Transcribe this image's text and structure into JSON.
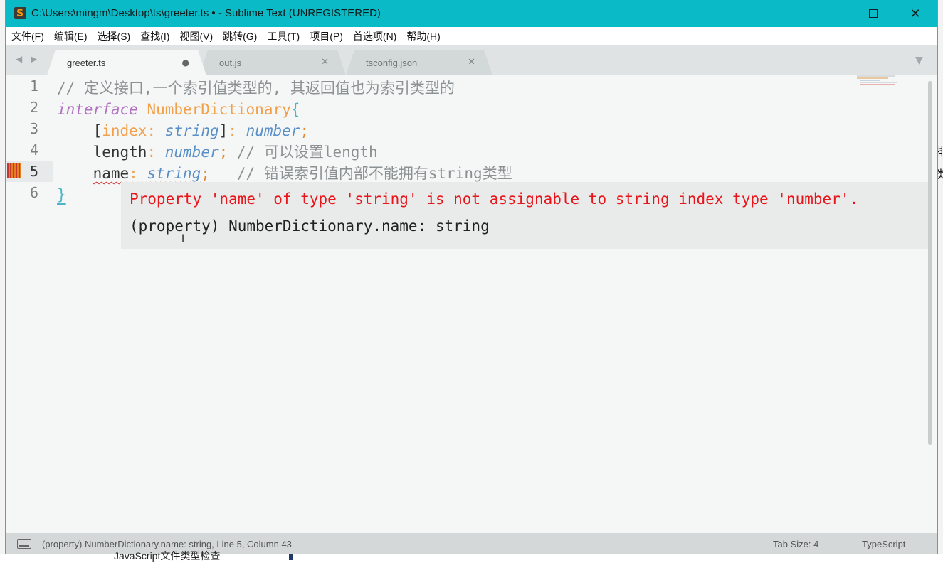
{
  "window": {
    "title": "C:\\Users\\mingm\\Desktop\\ts\\greeter.ts • - Sublime Text (UNREGISTERED)",
    "app_icon": "sublime-text-icon",
    "app_icon_glyph": "S",
    "close_glyph": "✕"
  },
  "menu": [
    "文件(F)",
    "编辑(E)",
    "选择(S)",
    "查找(I)",
    "视图(V)",
    "跳转(G)",
    "工具(T)",
    "项目(P)",
    "首选项(N)",
    "帮助(H)"
  ],
  "tab_nav": "◀ ▶",
  "tabs": [
    {
      "label": "greeter.ts",
      "state": "modified",
      "marker": "●"
    },
    {
      "label": "out.js",
      "state": "closeable",
      "marker": "✕"
    },
    {
      "label": "tsconfig.json",
      "state": "closeable",
      "marker": "✕"
    }
  ],
  "tab_overflow": "▼",
  "editor": {
    "line_numbers": [
      "1",
      "2",
      "3",
      "4",
      "5",
      "6"
    ],
    "current_line": 5,
    "lines": {
      "l1": {
        "comment": "// 定义接口,一个索引值类型的, 其返回值也为索引类型的"
      },
      "l2": {
        "keyword": "interface",
        "name": "NumberDictionary",
        "brace": "{"
      },
      "l3": {
        "indent": "    ",
        "open": "[",
        "prop": "index",
        "colon": ":",
        "type": "string",
        "close": "]",
        "colon2": ":",
        "type2": "number",
        "semi": ";"
      },
      "l4": {
        "indent": "    ",
        "prop": "length",
        "colon": ":",
        "type": "number",
        "semi": ";",
        "comment": " // 可以设置length"
      },
      "l5": {
        "indent": "    ",
        "prop": "name",
        "colon": ":",
        "type": "string",
        "semi": ";",
        "comment": "   // 错误索引值内部不能拥有string类型"
      },
      "l6": {
        "brace": "}"
      }
    },
    "popup": {
      "error": "Property 'name' of type 'string' is not assignable to string index type 'number'.",
      "info": "(property) NumberDictionary.name: string"
    },
    "text_cursor": "I"
  },
  "statusbar": {
    "message": "(property) NumberDictionary.name: string, Line 5, Column 43",
    "tab_size": "Tab Size: 4",
    "syntax": "TypeScript"
  },
  "background": {
    "fragment": "JavaScript文件类型检查",
    "right_fragment_1": "排",
    "right_fragment_2": "类"
  },
  "colors": {
    "titlebar": "#0abac6",
    "editor_bg": "#f5f7f7",
    "error_text": "#e8151b",
    "keyword": "#b36fc2",
    "type_name": "#f2a04a",
    "type": "#5a8fc7",
    "comment": "#8c9293"
  }
}
